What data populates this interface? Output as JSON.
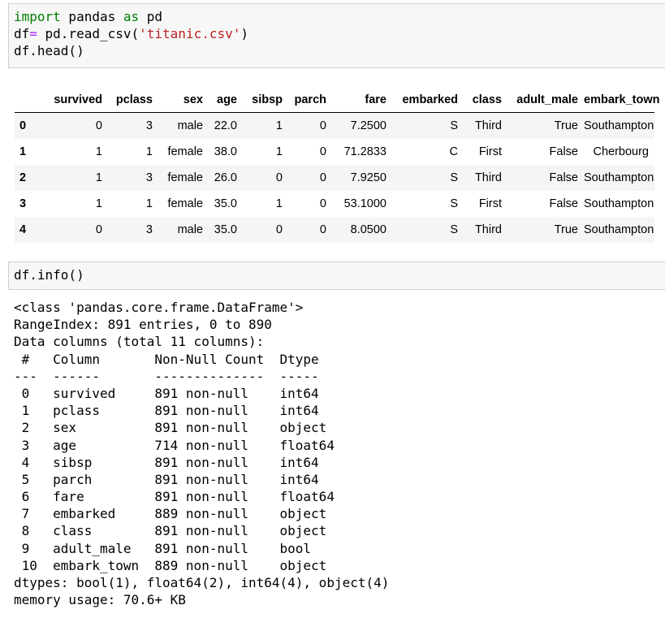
{
  "cell1": {
    "line1": {
      "kw1": "import",
      "mid": " pandas ",
      "kw2": "as",
      "end": " pd"
    },
    "line2": {
      "a": "df",
      "op": "=",
      "b": " pd.read_csv(",
      "str": "'titanic.csv'",
      "c": ")"
    },
    "line3": "df.head()"
  },
  "df_table": {
    "columns": [
      "",
      "survived",
      "pclass",
      "sex",
      "age",
      "sibsp",
      "parch",
      "fare",
      "embarked",
      "class",
      "adult_male",
      "embark_town"
    ],
    "rows": [
      [
        "0",
        "0",
        "3",
        "male",
        "22.0",
        "1",
        "0",
        "7.2500",
        "S",
        "Third",
        "True",
        "Southampton"
      ],
      [
        "1",
        "1",
        "1",
        "female",
        "38.0",
        "1",
        "0",
        "71.2833",
        "C",
        "First",
        "False",
        "Cherbourg"
      ],
      [
        "2",
        "1",
        "3",
        "female",
        "26.0",
        "0",
        "0",
        "7.9250",
        "S",
        "Third",
        "False",
        "Southampton"
      ],
      [
        "3",
        "1",
        "1",
        "female",
        "35.0",
        "1",
        "0",
        "53.1000",
        "S",
        "First",
        "False",
        "Southampton"
      ],
      [
        "4",
        "0",
        "3",
        "male",
        "35.0",
        "0",
        "0",
        "8.0500",
        "S",
        "Third",
        "True",
        "Southampton"
      ]
    ]
  },
  "cell2": {
    "line1": "df.info()"
  },
  "info_output": {
    "lines": [
      "<class 'pandas.core.frame.DataFrame'>",
      "RangeIndex: 891 entries, 0 to 890",
      "Data columns (total 11 columns):",
      " #   Column       Non-Null Count  Dtype  ",
      "---  ------       --------------  -----  ",
      " 0   survived     891 non-null    int64  ",
      " 1   pclass       891 non-null    int64  ",
      " 2   sex          891 non-null    object ",
      " 3   age          714 non-null    float64",
      " 4   sibsp        891 non-null    int64  ",
      " 5   parch        891 non-null    int64  ",
      " 6   fare         891 non-null    float64",
      " 7   embarked     889 non-null    object ",
      " 8   class        891 non-null    object ",
      " 9   adult_male   891 non-null    bool   ",
      " 10  embark_town  889 non-null    object ",
      "dtypes: bool(1), float64(2), int64(4), object(4)",
      "memory usage: 70.6+ KB"
    ]
  }
}
